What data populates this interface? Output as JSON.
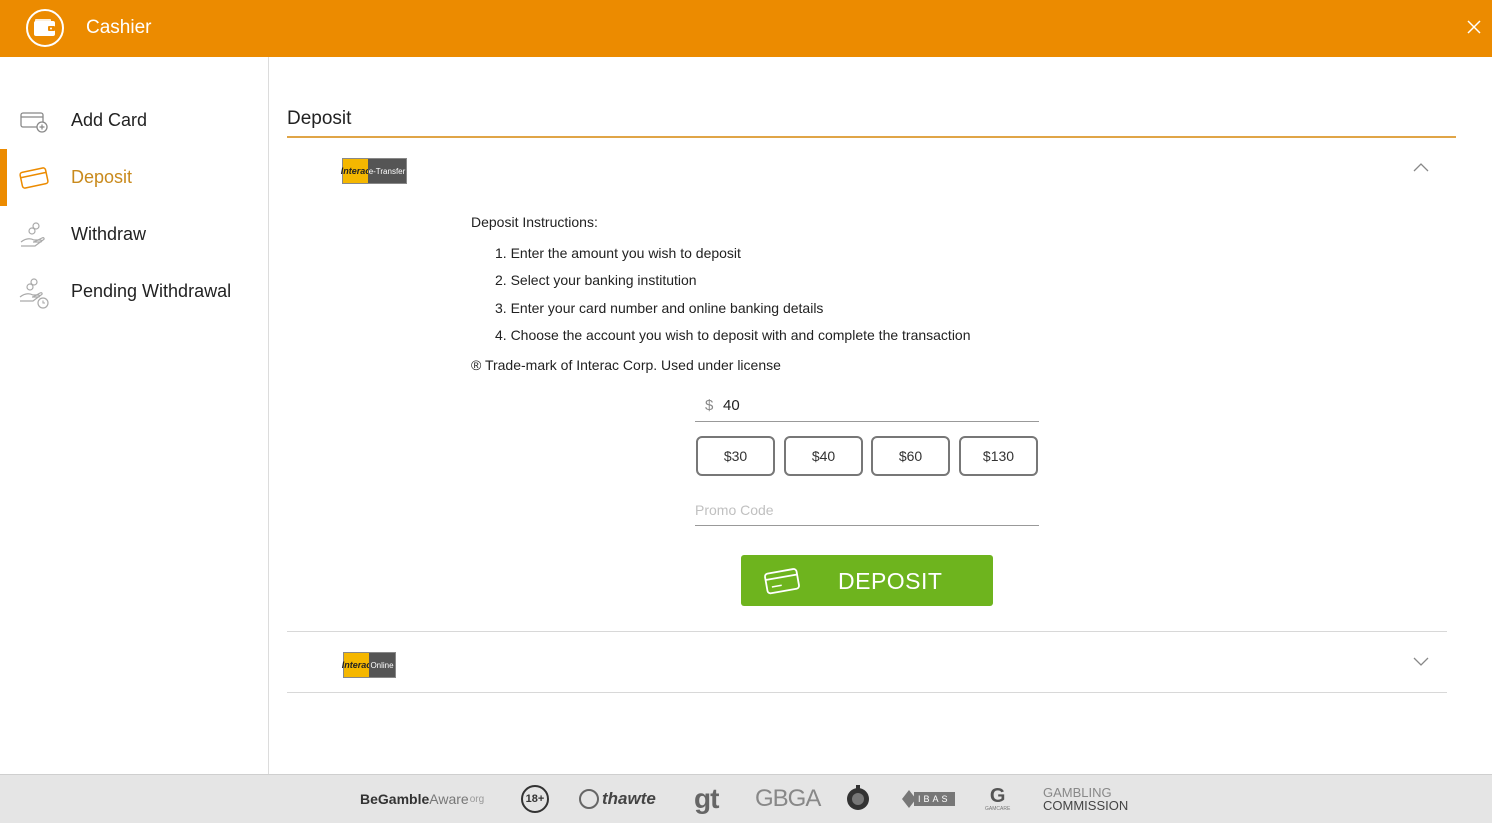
{
  "header": {
    "title": "Cashier",
    "logo_icon": "wallet-icon",
    "close_icon": "close-icon",
    "background_color": "#ec8b00"
  },
  "sidebar": {
    "items": [
      {
        "label": "Add Card",
        "icon": "add-card-icon",
        "active": false
      },
      {
        "label": "Deposit",
        "icon": "card-icon",
        "active": true
      },
      {
        "label": "Withdraw",
        "icon": "hand-coins-icon",
        "active": false
      },
      {
        "label": "Pending Withdrawal",
        "icon": "hand-coins-clock-icon",
        "active": false
      }
    ],
    "active_color": "#ec8b00"
  },
  "main": {
    "title": "Deposit",
    "methods": [
      {
        "logo_left": "Interac",
        "logo_right": "e-Transfer",
        "expanded": true,
        "instructions_title": "Deposit Instructions:",
        "steps": [
          "1. Enter the amount you wish to deposit",
          "2. Select your banking institution",
          "3. Enter your card number and online banking details",
          "4. Choose the account you wish to deposit with and complete the transaction"
        ],
        "trademark": "® Trade-mark of Interac Corp. Used under license",
        "amount": {
          "currency": "$",
          "value": "40"
        },
        "quick_amounts": [
          "$30",
          "$40",
          "$60",
          "$130"
        ],
        "promo": {
          "placeholder": "Promo Code",
          "value": ""
        },
        "deposit_button": "DEPOSIT",
        "deposit_color": "#6eb41e"
      },
      {
        "logo_left": "Interac",
        "logo_right": "Online",
        "expanded": false
      }
    ]
  },
  "footer": {
    "logos": {
      "begambleaware_a": "BeGamble",
      "begambleaware_b": "Aware",
      "begambleaware_c": "org",
      "age": "18+",
      "thawte": "thawte",
      "gt": "gt",
      "gbga": "GBGA",
      "ibas": "IBAS",
      "gamcare": "GAMCARE",
      "gambling_1": "GAMBLING",
      "gambling_2": "COMMISSION"
    }
  }
}
